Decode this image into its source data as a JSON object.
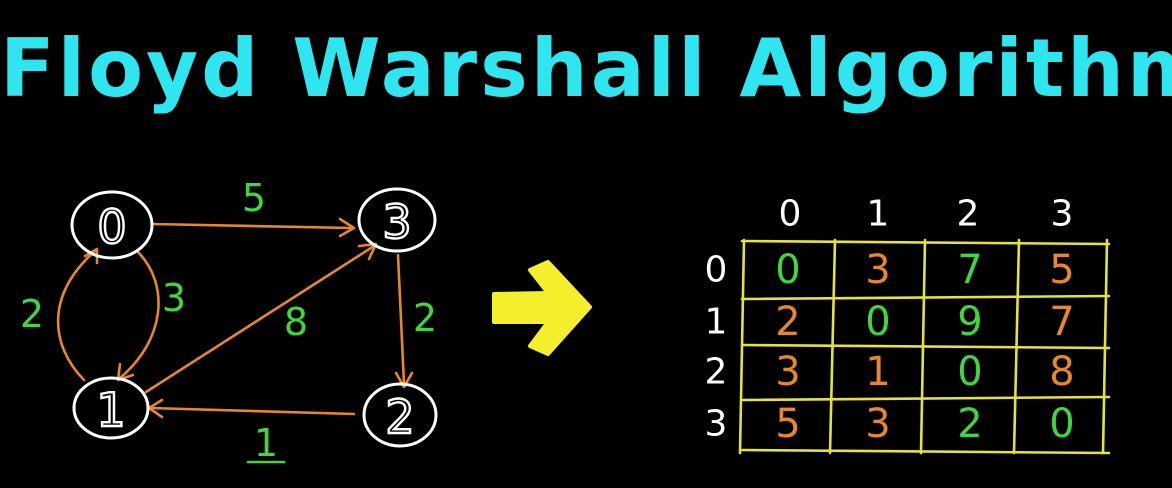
{
  "title": "Floyd Warshall Algorithm",
  "colors": {
    "title": "#2fe6f0",
    "node": "#ffffff",
    "edge": "#e8872a",
    "weight": "#3ed83e",
    "arrow": "#f4ee2c",
    "grid": "#e6e23a",
    "value_zero_or_direct_green": "#3ed83e",
    "value_orange": "#e8872a"
  },
  "graph": {
    "nodes": [
      {
        "id": "0",
        "label": "0"
      },
      {
        "id": "1",
        "label": "1"
      },
      {
        "id": "2",
        "label": "2"
      },
      {
        "id": "3",
        "label": "3"
      }
    ],
    "edges": [
      {
        "from": "0",
        "to": "3",
        "weight": "5"
      },
      {
        "from": "1",
        "to": "0",
        "weight": "2"
      },
      {
        "from": "0",
        "to": "1",
        "weight": "3"
      },
      {
        "from": "1",
        "to": "3",
        "weight": "8"
      },
      {
        "from": "3",
        "to": "2",
        "weight": "2"
      },
      {
        "from": "2",
        "to": "1",
        "weight": "1"
      }
    ]
  },
  "transform_arrow_icon": "right-arrow-icon",
  "matrix": {
    "col_headers": [
      "0",
      "1",
      "2",
      "3"
    ],
    "row_headers": [
      "0",
      "1",
      "2",
      "3"
    ],
    "cells": [
      [
        {
          "v": "0",
          "c": "green"
        },
        {
          "v": "3",
          "c": "orange"
        },
        {
          "v": "7",
          "c": "green"
        },
        {
          "v": "5",
          "c": "orange"
        }
      ],
      [
        {
          "v": "2",
          "c": "orange"
        },
        {
          "v": "0",
          "c": "green"
        },
        {
          "v": "9",
          "c": "green"
        },
        {
          "v": "7",
          "c": "orange"
        }
      ],
      [
        {
          "v": "3",
          "c": "orange"
        },
        {
          "v": "1",
          "c": "orange"
        },
        {
          "v": "0",
          "c": "green"
        },
        {
          "v": "8",
          "c": "orange"
        }
      ],
      [
        {
          "v": "5",
          "c": "orange"
        },
        {
          "v": "3",
          "c": "orange"
        },
        {
          "v": "2",
          "c": "green"
        },
        {
          "v": "0",
          "c": "green"
        }
      ]
    ]
  }
}
